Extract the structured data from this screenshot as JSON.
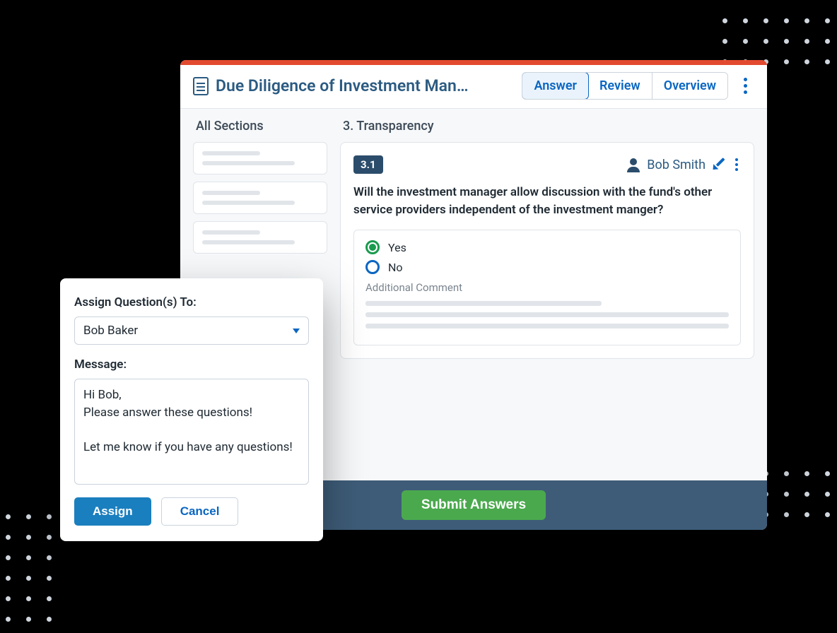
{
  "header": {
    "title": "Due Diligence of Investment Man…",
    "tabs": [
      {
        "label": "Answer",
        "active": true
      },
      {
        "label": "Review",
        "active": false
      },
      {
        "label": "Overview",
        "active": false
      }
    ]
  },
  "sidebar": {
    "title": "All Sections",
    "item_count": 3
  },
  "section": {
    "title": "3. Transparency",
    "question": {
      "number": "3.1",
      "assignee": "Bob Smith",
      "text": "Will the investment manager allow discussion with the fund's other service providers independent of the investment manger?",
      "options": [
        {
          "label": "Yes",
          "selected": true
        },
        {
          "label": "No",
          "selected": false
        }
      ],
      "comment_label": "Additional Comment"
    }
  },
  "footer": {
    "submit_label": "Submit Answers"
  },
  "assign_modal": {
    "assign_label": "Assign Question(s) To:",
    "assignee_selected": "Bob Baker",
    "message_label": "Message:",
    "message_value": "Hi Bob,\nPlease answer these questions!\n\nLet me know if you have any questions!",
    "assign_button": "Assign",
    "cancel_button": "Cancel"
  }
}
